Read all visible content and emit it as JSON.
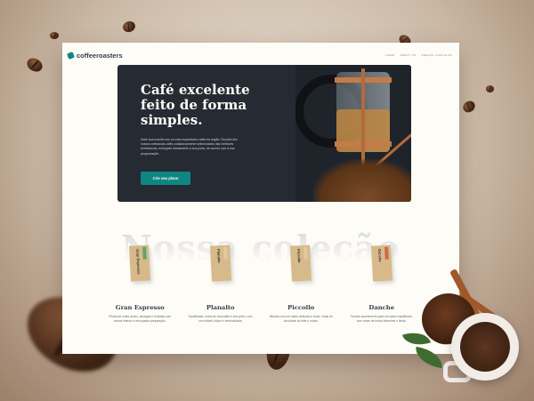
{
  "nav": {
    "logo": "coffeeroasters",
    "links": [
      "HOME",
      "ABOUT US",
      "CREATE YOUR PLAN"
    ]
  },
  "hero": {
    "title": "Café excelente feito de forma simples.",
    "text": "Inicie sua manhã com os mais requintados cafés da região. Escolha dos nossos artesanais cafés cuidadosamente selecionados das melhores torrefadoras, entregues diretamente à sua porta, de acordo com a sua programação.",
    "button": "Crie seu plano"
  },
  "collection": {
    "title": "Nossa coleção",
    "products": [
      {
        "name": "Gran Espresso",
        "bag_label": "Gran Espresso",
        "accent": "#5ba86e",
        "desc": "Pitada de notas doces, amargas e frutadas com aroma intenso e encorpada preparação."
      },
      {
        "name": "Planalto",
        "bag_label": "Planalto",
        "accent": "#d8b98a",
        "desc": "Equilibrado, notas de chocolate e chá preto, com um notável dulçor e cremosidade."
      },
      {
        "name": "Piccollo",
        "bag_label": "Piccollo",
        "accent": "#d8b98a",
        "desc": "Mistura com um sabor delicado e doce, notas de chocolate ao leite e nozes."
      },
      {
        "name": "Danche",
        "bag_label": "Danche",
        "accent": "#c96b4a",
        "desc": "Torrado suavemente para um sabor equilibrado, com notas de frutas silvestres e limão."
      }
    ]
  }
}
